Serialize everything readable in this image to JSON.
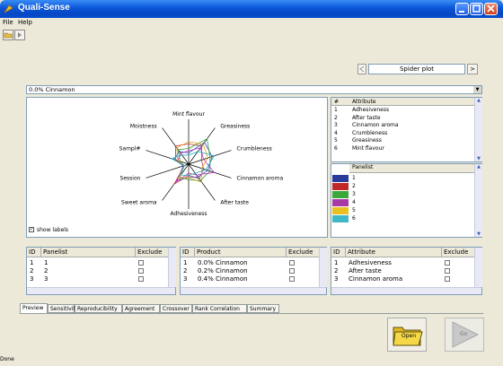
{
  "window": {
    "title": "Quali-Sense"
  },
  "menu": [
    "File",
    "Help"
  ],
  "selector": {
    "value": "Spider plot",
    "next": ">"
  },
  "product_dropdown": {
    "value": "0.0% Cinnamon"
  },
  "spider": {
    "axes": [
      "Mint flavour",
      "Greasiness",
      "Crumbleness",
      "Cinnamon aroma",
      "After taste",
      "Adhesiveness",
      "Sweet aroma",
      "Session",
      "Sampl#",
      "Moistness"
    ],
    "show_labels": "show labels",
    "colors": [
      "#c03030",
      "#3050c0",
      "#30a030",
      "#c030c0",
      "#e0a020",
      "#20b0c0"
    ]
  },
  "attribute_list": {
    "headers": [
      "#",
      "Attribute"
    ],
    "rows": [
      [
        "1",
        "Adhesiveness"
      ],
      [
        "2",
        "After taste"
      ],
      [
        "3",
        "Cinnamon aroma"
      ],
      [
        "4",
        "Crumbleness"
      ],
      [
        "5",
        "Greasiness"
      ],
      [
        "6",
        "Mint flavour"
      ]
    ]
  },
  "panelist_list": {
    "header": "Panelist",
    "rows": [
      {
        "label": "1",
        "color": "#2a3a9a"
      },
      {
        "label": "2",
        "color": "#c02828"
      },
      {
        "label": "3",
        "color": "#3aa83a"
      },
      {
        "label": "4",
        "color": "#a83aa8"
      },
      {
        "label": "5",
        "color": "#e8c020"
      },
      {
        "label": "6",
        "color": "#40b8c8"
      }
    ]
  },
  "grids": [
    {
      "headers": [
        "ID",
        "Panelist",
        "Exclude"
      ],
      "rows": [
        [
          "1",
          "1"
        ],
        [
          "2",
          "2"
        ],
        [
          "3",
          "3"
        ]
      ]
    },
    {
      "headers": [
        "ID",
        "Product",
        "Exclude"
      ],
      "rows": [
        [
          "1",
          "0.0% Cinnamon"
        ],
        [
          "2",
          "0.2% Cinnamon"
        ],
        [
          "3",
          "0.4% Cinnamon"
        ]
      ]
    },
    {
      "headers": [
        "ID",
        "Attribute",
        "Exclude"
      ],
      "rows": [
        [
          "1",
          "Adhesiveness"
        ],
        [
          "2",
          "After taste"
        ],
        [
          "3",
          "Cinnamon aroma"
        ]
      ]
    }
  ],
  "tabs": [
    "Preview",
    "Sensitivity",
    "Reproducibility",
    "Agreement",
    "Crossover",
    "Rank Correlation",
    "Summary"
  ],
  "buttons": {
    "open": "Open",
    "go": "Go"
  },
  "status": "Done"
}
